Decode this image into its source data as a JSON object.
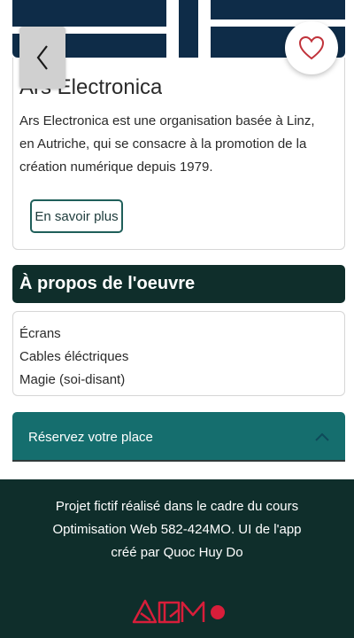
{
  "hero": {
    "colors": {
      "background": "#0e2c48",
      "stripes": "#ffffff"
    }
  },
  "nav": {
    "back_icon": "chevron-left-icon",
    "favorite_icon": "heart-outline-icon",
    "favorite_color": "#c0323a"
  },
  "card": {
    "title": "Ars Electronica",
    "description": "Ars Electronica est une organisation basée à Linz, en Autriche, qui se consacre à la promotion de la création numérique depuis 1979.",
    "more_label": "En savoir plus"
  },
  "about": {
    "heading": "À propos de l'oeuvre",
    "materials": [
      "Écrans",
      "Cables éléctriques",
      "Magie (soi-disant)"
    ]
  },
  "reserve": {
    "label": "Réservez votre place",
    "icon": "chevron-up-icon",
    "accent": "#156e6e"
  },
  "footer": {
    "line1": "Projet fictif réalisé dans le cadre du cours",
    "line2": "Optimisation Web 582-424MO. UI de l'app",
    "line3": "créé par Quoc Huy Do",
    "logo_icon": "aqm-logo",
    "logo_color": "#d81e3a",
    "background": "#0f2e2b"
  }
}
